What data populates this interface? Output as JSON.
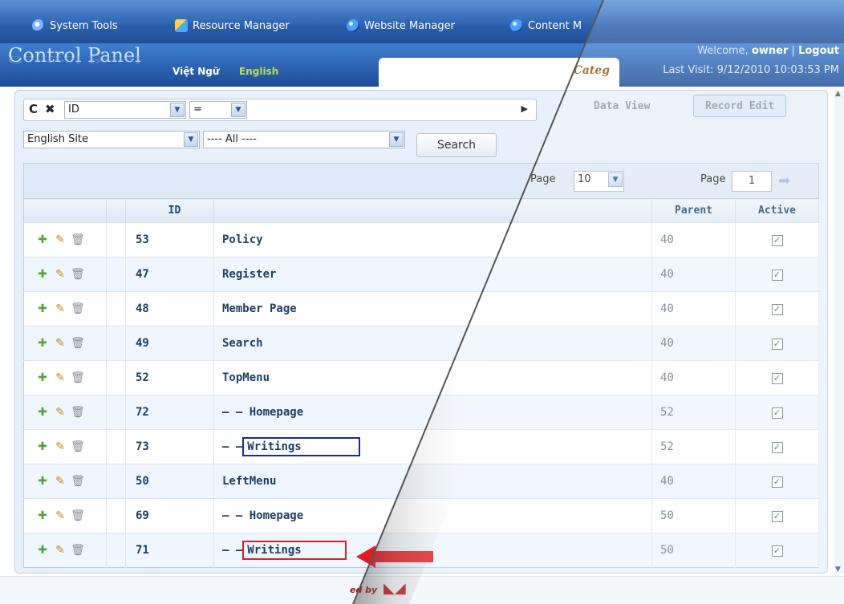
{
  "topmenu": {
    "items": [
      {
        "label": "System Tools",
        "icon": "system-tools-icon"
      },
      {
        "label": "Resource Manager",
        "icon": "resource-manager-icon"
      },
      {
        "label": "Website Manager",
        "icon": "website-manager-icon"
      },
      {
        "label": "Content M",
        "icon": "content-manager-icon"
      }
    ]
  },
  "header": {
    "title": "Control Panel",
    "lang_vn": "Việt Ngữ",
    "lang_en": "English",
    "welcome_prefix": "Welcome,",
    "user": "owner",
    "separator": "|",
    "logout": "Logout",
    "last_visit": "Last Visit: 9/12/2010 10:03:53 PM",
    "current_tab": "Categ"
  },
  "view_tabs": {
    "data_view": "Data View",
    "record_edit": "Record Edit"
  },
  "filter": {
    "field": "ID",
    "operator": "=",
    "value": "",
    "site": "English Site",
    "category": "---- All ----",
    "search_label": "Search",
    "go_icon": "play-icon"
  },
  "pager": {
    "page_label": "Page",
    "page_size": "10",
    "page_label2": "Page",
    "page_number": "1"
  },
  "table": {
    "headers": {
      "id": "ID",
      "name": "",
      "parent": "Parent",
      "active": "Active"
    },
    "rows": [
      {
        "id": "53",
        "name": "Policy",
        "parent": "40"
      },
      {
        "id": "47",
        "name": "Register",
        "parent": "40"
      },
      {
        "id": "48",
        "name": "Member Page",
        "parent": "40"
      },
      {
        "id": "49",
        "name": "Search",
        "parent": "40"
      },
      {
        "id": "52",
        "name": "TopMenu",
        "parent": "40"
      },
      {
        "id": "72",
        "name": "— — Homepage",
        "parent": "52"
      },
      {
        "id": "73",
        "prefix": "— —",
        "name": "Writings",
        "parent": "52"
      },
      {
        "id": "50",
        "name": "LeftMenu",
        "parent": "40"
      },
      {
        "id": "69",
        "name": "— — Homepage",
        "parent": "50"
      },
      {
        "id": "71",
        "prefix": "— —",
        "name": "Writings",
        "parent": "50"
      }
    ]
  },
  "footer": {
    "powered": "ed by"
  },
  "colors": {
    "accent": "#2a5fae",
    "highlight_blue": "#1d2a9a",
    "highlight_red": "#d3222a",
    "arrow": "#e21b22"
  }
}
